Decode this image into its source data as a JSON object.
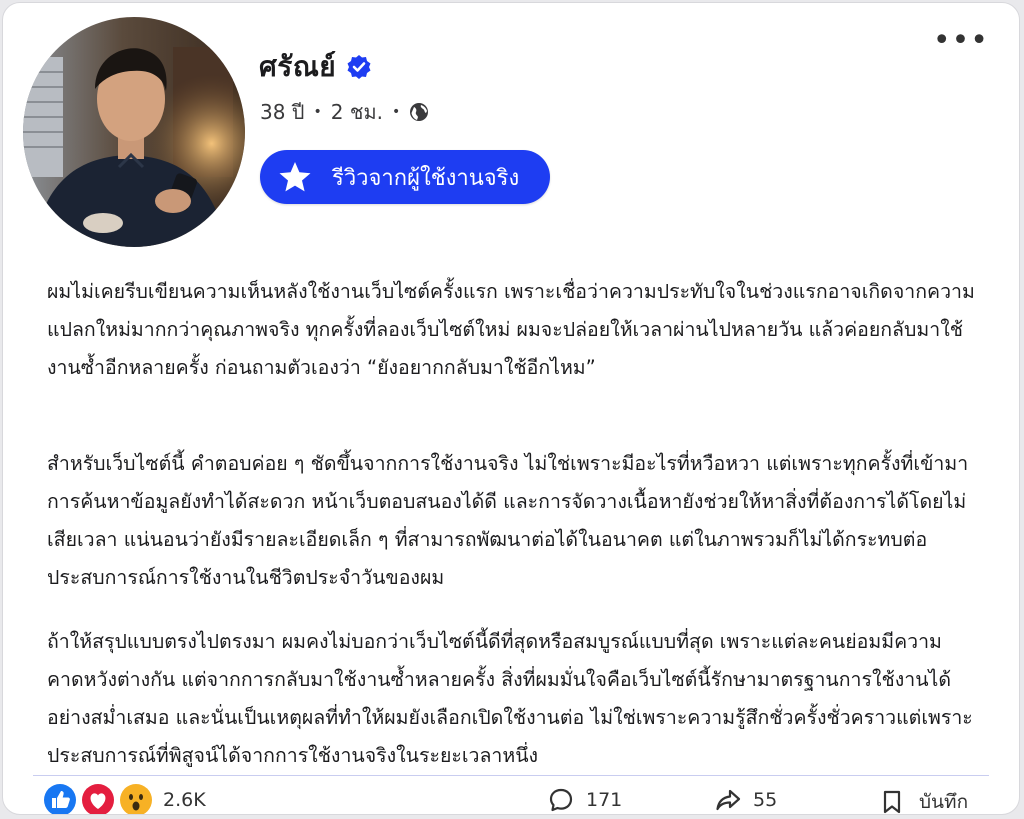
{
  "post": {
    "author_name": "ศรัณย์",
    "age": "38 ปี",
    "time": "2 ชม.",
    "meta_separator": "•",
    "badge_label": "รีวิวจากผู้ใช้งานจริง",
    "paragraphs": [
      "ผมไม่เคยรีบเขียนความเห็นหลังใช้งานเว็บไซต์ครั้งแรก เพราะเชื่อว่าความประทับใจในช่วงแรกอาจเกิดจากความแปลกใหม่มากกว่าคุณภาพจริง ทุกครั้งที่ลองเว็บไซต์ใหม่ ผมจะปล่อยให้เวลาผ่านไปหลายวัน แล้วค่อยกลับมาใช้งานซ้ำอีกหลายครั้ง ก่อนถามตัวเองว่า “ยังอยากกลับมาใช้อีกไหม”",
      "สำหรับเว็บไซต์นี้ คำตอบค่อย ๆ ชัดขึ้นจากการใช้งานจริง ไม่ใช่เพราะมีอะไรที่หวือหวา แต่เพราะทุกครั้งที่เข้ามาการค้นหาข้อมูลยังทำได้สะดวก หน้าเว็บตอบสนองได้ดี และการจัดวางเนื้อหายังช่วยให้หาสิ่งที่ต้องการได้โดยไม่เสียเวลา แน่นอนว่ายังมีรายละเอียดเล็ก ๆ ที่สามารถพัฒนาต่อได้ในอนาคต แต่ในภาพรวมก็ไม่ได้กระทบต่อประสบการณ์การใช้งานในชีวิตประจำวันของผม",
      "ถ้าให้สรุปแบบตรงไปตรงมา ผมคงไม่บอกว่าเว็บไซต์นี้ดีที่สุดหรือสมบูรณ์แบบที่สุด เพราะแต่ละคนย่อมมีความคาดหวังต่างกัน แต่จากการกลับมาใช้งานซ้ำหลายครั้ง สิ่งที่ผมมั่นใจคือเว็บไซต์นี้รักษามาตรฐานการใช้งานได้อย่างสม่ำเสมอ และนั่นเป็นเหตุผลที่ทำให้ผมยังเลือกเปิดใช้งานต่อ ไม่ใช่เพราะความรู้สึกชั่วครั้งชั่วคราวแต่เพราะประสบการณ์ที่พิสูจน์ได้จากการใช้งานจริงในระยะเวลาหนึ่ง"
    ]
  },
  "footer": {
    "reaction_icons": [
      "like-icon",
      "love-icon",
      "wow-icon"
    ],
    "reaction_count": "2.6K",
    "comment_count": "171",
    "share_count": "55",
    "save_label": "บันทึก"
  },
  "colors": {
    "badge_bg": "#1e3df2",
    "verified": "#1e3df2",
    "like": "#1877f2",
    "love": "#e41e3f",
    "wow": "#f7b125"
  }
}
